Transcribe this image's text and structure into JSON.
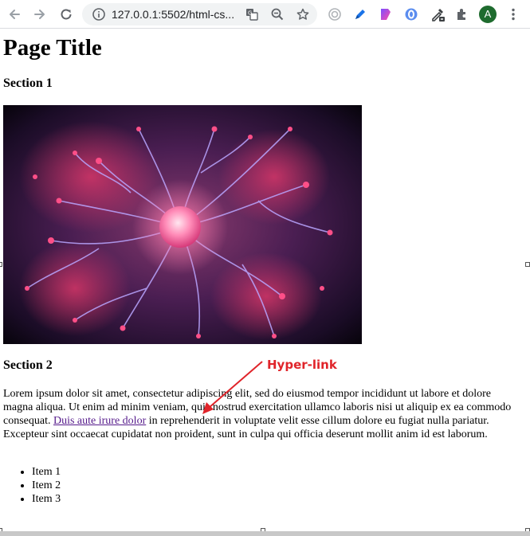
{
  "browser": {
    "url": "127.0.0.1:5502/html-cs...",
    "avatar_letter": "A",
    "avatar_color": "#1e6b2e",
    "icons": [
      "back-arrow-icon",
      "forward-arrow-icon",
      "reload-icon",
      "info-icon",
      "translate-icon",
      "zoom-out-icon",
      "bookmark-star-icon",
      "extension-target-icon",
      "extension-pen-icon",
      "extension-gradient-icon",
      "extension-o-icon",
      "eyedropper-icon",
      "puzzle-extensions-icon",
      "kebab-menu-icon"
    ]
  },
  "page": {
    "title": "Page Title",
    "section1_heading": "Section 1",
    "section2_heading": "Section 2",
    "paragraph_before_link": "Lorem ipsum dolor sit amet, consectetur adipiscing elit, sed do eiusmod tempor incididunt ut labore et dolore magna aliqua. Ut enim ad minim veniam, quis nostrud exercitation ullamco laboris nisi ut aliquip ex ea commodo consequat. ",
    "link_text": "Duis aute irure dolor",
    "paragraph_after_link": " in reprehenderit in voluptate velit esse cillum dolore eu fugiat nulla pariatur. Excepteur sint occaecat cupidatat non proident, sunt in culpa qui officia deserunt mollit anim id est laborum.",
    "list_items": [
      "Item 1",
      "Item 2",
      "Item 3"
    ]
  },
  "annotation": {
    "label": "Hyper-link",
    "color": "#e0242a"
  },
  "colors": {
    "link_visited": "#551a8b"
  }
}
